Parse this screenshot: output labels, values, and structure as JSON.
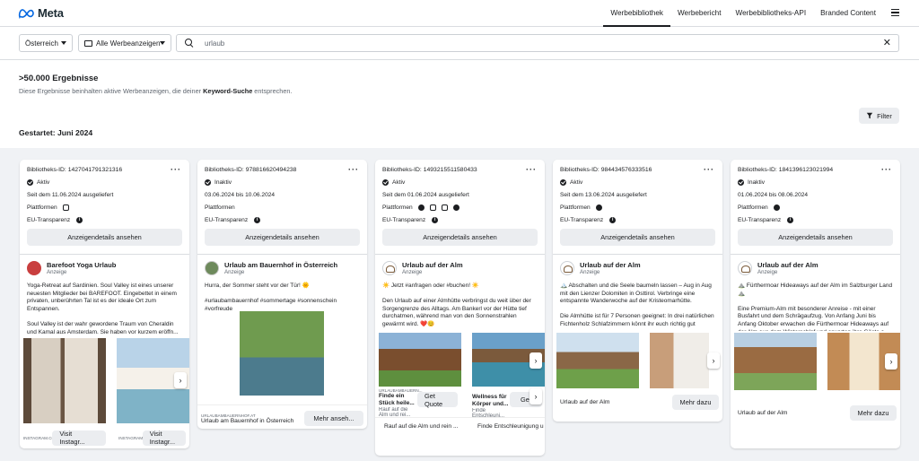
{
  "brand": {
    "logo_text": "Meta"
  },
  "nav": {
    "items": [
      "Werbebibliothek",
      "Werbebericht",
      "Werbebibliotheks-API",
      "Branded Content"
    ],
    "active": "Werbebibliothek"
  },
  "filters": {
    "country": "Österreich",
    "ad_type": "Alle Werbeanzeigen",
    "search_value": "urlaub"
  },
  "results": {
    "count": ">50.000 Ergebnisse",
    "desc_pre": "Diese Ergebnisse beinhalten aktive Werbeanzeigen, die deiner ",
    "desc_bold": "Keyword-Suche",
    "desc_post": " entsprechen.",
    "filter_label": "Filter",
    "started": "Gestartet: Juni 2024"
  },
  "labels": {
    "platforms": "Plattformen",
    "eu": "EU-Transparenz",
    "details": "Anzeigendetails ansehen",
    "sponsored": "Anzeige"
  },
  "cards": [
    {
      "lib_id": "Bibliotheks-ID: 1427041791321316",
      "status": "Aktiv",
      "date": "Seit dem 11.06.2024 ausgeliefert",
      "advertiser": "Barefoot Yoga Urlaub",
      "text": "Yoga-Retreat auf Sardinien. Soul Valley ist eines unserer neuesten Mitglieder bei BAREFOOT. Eingebettet in einem privaten, unberührten Tal ist es der ideale Ort zum Entspannen.\n\nSoul Valley ist der wahr gewordene Traum von Cheraldin und Kamal aus Amsterdam. Sie haben vor kurzem eröffn...",
      "cta1_src": "INSTAGRAM.COM",
      "cta1": "Visit Instagr...",
      "cta2_src": "INSTAGRAM.COM",
      "cta2": "Visit Instagr..."
    },
    {
      "lib_id": "Bibliotheks-ID: 978816620494238",
      "status": "Inaktiv",
      "date": "03.06.2024 bis 10.06.2024",
      "advertiser": "Urlaub am Bauernhof in Österreich",
      "text": "Hurra, der Sommer steht vor der Tür! 🌞\n\n#urlaubambauernhof #sommertage #sonnenschein #vorfreude",
      "cta_src": "URLAUBAMBAUERNHOF.AT",
      "caption": "Urlaub am Bauernhof in Österreich",
      "cta": "Mehr anseh..."
    },
    {
      "lib_id": "Bibliotheks-ID: 1493215511580433",
      "status": "Aktiv",
      "date": "Seit dem 01.06.2024 ausgeliefert",
      "advertiser": "Urlaub auf der Alm",
      "text": "☀️ Jetzt #anfragen oder #buchen! ☀️\n\nDen Urlaub auf einer Almhütte verbringst du weit über der Sorgengrenze des Alltags. Am Bankerl vor der Hütte tief durchatmen, während man von den Sonnenstrahlen gewärmt wird. ❤️😊\n...",
      "cta_src": "URLAUBAMBAUERN...",
      "title1": "Finde ein Stück heile...",
      "sub1": "Rauf auf die Alm und rei...",
      "cta": "Get Quote",
      "title2": "Wellness für Körper und...",
      "sub2": "Finde Entschleuni...",
      "cta2": "Get",
      "footer1": "Rauf auf die Alm und rein ...",
      "footer2": "Finde Entschleunigung un"
    },
    {
      "lib_id": "Bibliotheks-ID: 984434576333516",
      "status": "Aktiv",
      "date": "Seit dem 13.06.2024 ausgeliefert",
      "advertiser": "Urlaub auf der Alm",
      "text": "🏔️ Abschalten und die Seele baumeln lassen – Aug in Aug mit den Lienzer Dolomiten in Osttirol. Verbringe eine entspannte Wanderwoche auf der Kristeomarhütte.\n\nDie Almhütte ist für 7 Personen geeignet: In drei natürlichen Fichtenholz Schlafzimmern könnt ihr euch richtig gut erholen. Im vorderen Doppelzimmer und dem...",
      "caption": "Urlaub auf der Alm",
      "cta": "Mehr dazu"
    },
    {
      "lib_id": "Bibliotheks-ID: 1841396123021994",
      "status": "Inaktiv",
      "date": "01.06.2024 bis 08.06.2024",
      "advertiser": "Urlaub auf der Alm",
      "text": "⛰️ Fürthermoar Hideaways auf der Alm im Salzburger Land ⛰️\n\nEine Premium-Alm mit besonderer Anreise - mit einer Busfahrt und dem Schrägaufzug. Von Anfang Juni bis Anfang Oktober erwachen die Fürthermoar Hideaways auf der Alm aus dem Winterschlaf und erwarten ihre Gäste a...",
      "caption": "Urlaub auf der Alm",
      "cta": "Mehr dazu"
    }
  ]
}
